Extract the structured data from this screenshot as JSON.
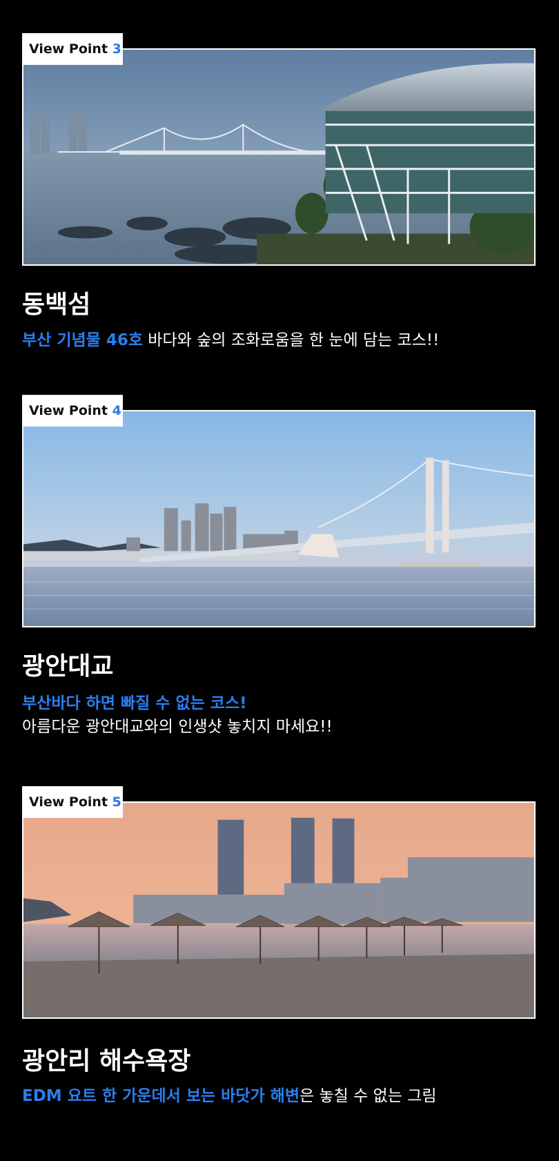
{
  "sections": [
    {
      "badge_label": "View Point",
      "badge_number": "3",
      "title": "동백섬",
      "highlight": "부산 기념물 46호",
      "rest": " 바다와 숲의 조화로움을 한 눈에 담는 코스!!"
    },
    {
      "badge_label": "View Point",
      "badge_number": "4",
      "title": "광안대교",
      "highlight": "부산바다 하면 빠질 수 없는 코스!",
      "line2": "아름다운 광안대교와의 인생샷 놓치지 마세요!!"
    },
    {
      "badge_label": "View Point",
      "badge_number": "5",
      "title": "광안리 해수욕장",
      "highlight": "EDM 요트 한 가운데서 보는 바닷가 해변",
      "rest": "은 놓칠 수 없는 그림"
    }
  ],
  "colors": {
    "background": "#000000",
    "accent_blue": "#2a7ff0",
    "badge_number": "#2a78e4"
  }
}
